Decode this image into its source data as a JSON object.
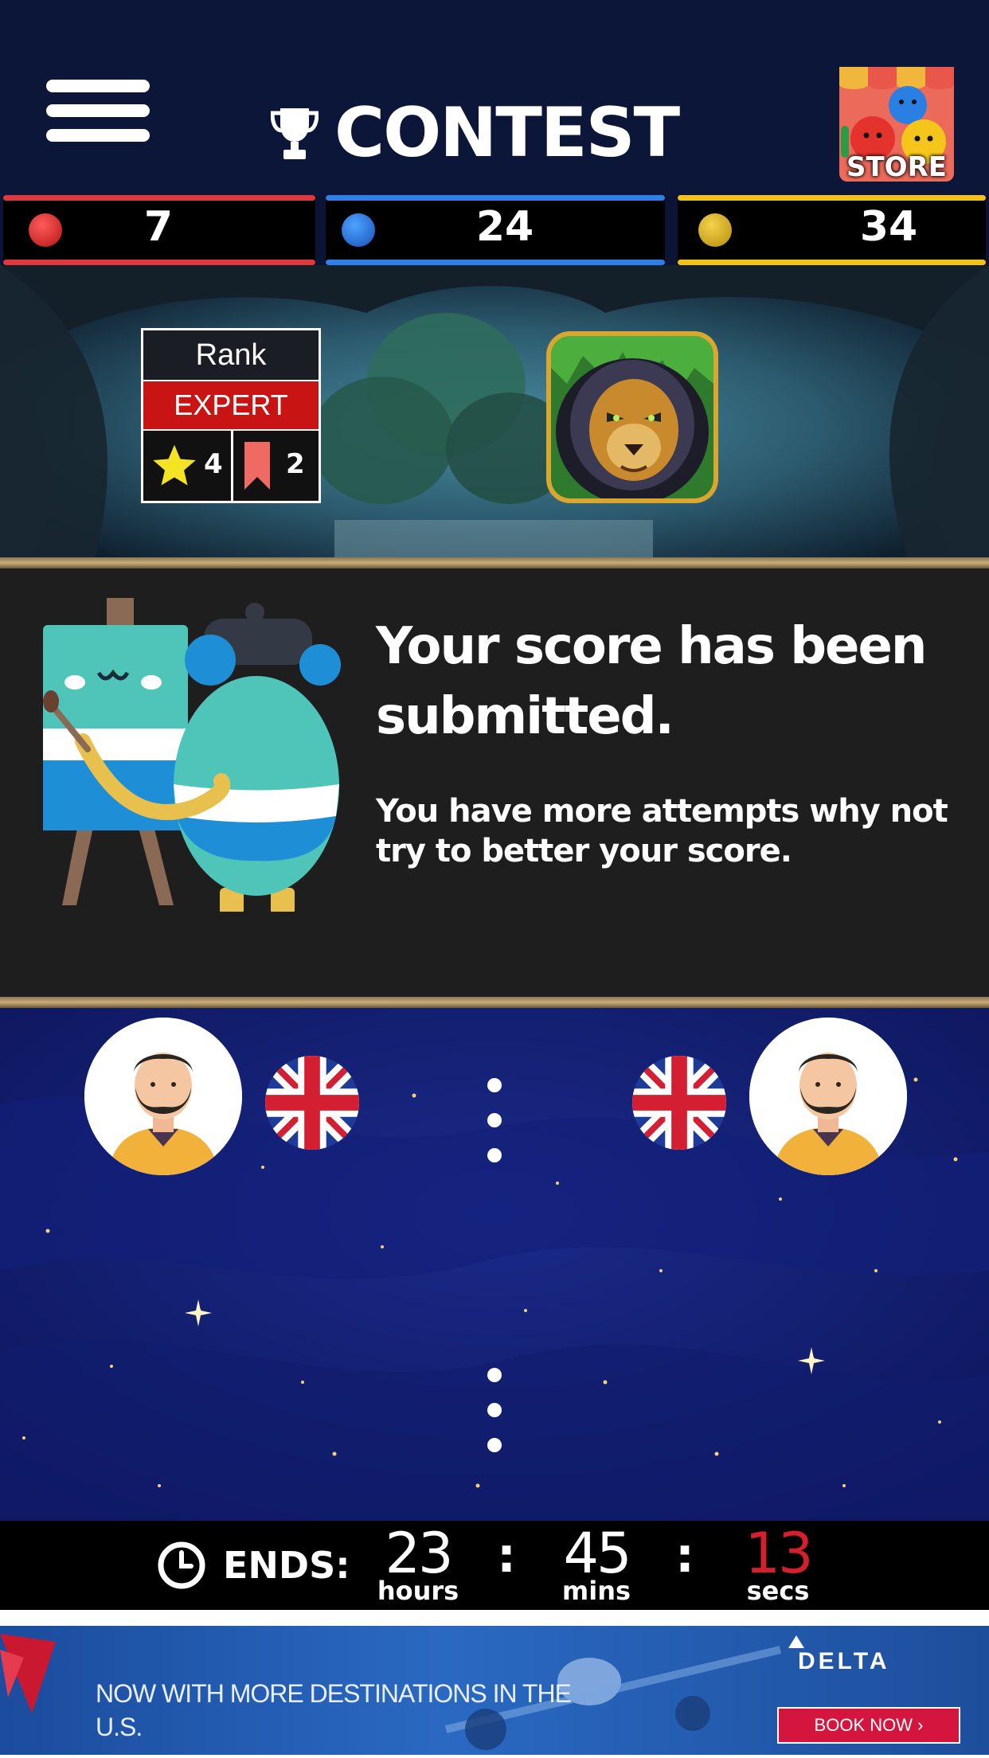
{
  "header": {
    "title": "CONTEST",
    "store_label": "STORE",
    "icons": [
      "menu-icon",
      "trophy-icon",
      "store-icon"
    ]
  },
  "scores": [
    {
      "color": "#e0383e",
      "value": "7"
    },
    {
      "color": "#2f7fe8",
      "value": "24"
    },
    {
      "color": "#f2c21a",
      "value": "34"
    }
  ],
  "rank": {
    "label": "Rank",
    "value": "EXPERT",
    "stars": "4",
    "tags": "2"
  },
  "message": {
    "title": "Your score has been submitted.",
    "body": "You have more attempts why not try to better your score."
  },
  "timer": {
    "label": "ENDS:",
    "hours": "23",
    "hours_unit": "hours",
    "mins": "45",
    "mins_unit": "mins",
    "secs": "13",
    "secs_unit": "secs",
    "secs_color": "#d61f2c"
  },
  "ad": {
    "text": "NOW WITH MORE DESTINATIONS IN THE U.S.",
    "brand": "DELTA",
    "cta": "BOOK NOW ›"
  }
}
